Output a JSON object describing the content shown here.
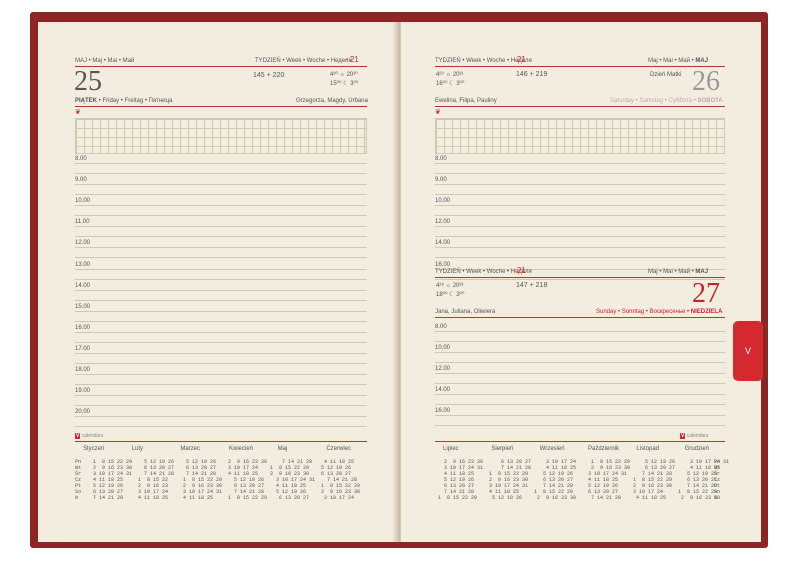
{
  "left_page": {
    "month_header": "MAJ • Maj • Mai • Май",
    "week_label": "TYDZIEŃ • Week • Woche • Неделя",
    "week_number": "- 21",
    "day_number": "25",
    "day_of_year": "145 + 220",
    "sunrise": "4³⁰ ☼ 20³⁰",
    "moonrise": "15⁰⁰ ☾ 3⁰⁰",
    "day_name_strong": "PIĄTEK",
    "day_name_rest": "• Friday • Freitag • Пятница",
    "name_days": "Grzegorza, Magdy, Urbana",
    "times": [
      "8.00",
      "9.00",
      "10.00",
      "11.00",
      "12.00",
      "13.00",
      "14.00",
      "15.00",
      "16.00",
      "17.00",
      "18.00",
      "19.00",
      "20.00"
    ]
  },
  "right_page": {
    "week_label": "TYDZIEŃ • Week • Woche • Неделя",
    "week_number": "- 21",
    "month_header": "Maj • Mai • Май •",
    "month_header_strong": "MAJ",
    "sunrise": "4²⁹ ☼ 20³¹",
    "moonrise": "16⁰⁰ ☾ 3⁰⁰",
    "day_of_year": "146 + 219",
    "day_number": "26",
    "special_day": "Dzień Matki",
    "name_days": "Ewelina, Filipa, Pauliny",
    "day_name_rest": "Saturday • Samstag • Суббота •",
    "day_name_strong": "SOBOTA",
    "times": [
      "8.00",
      "9.00",
      "10.00",
      "12.00",
      "14.00",
      "16.00"
    ]
  },
  "sunday_section": {
    "week_label": "TYDZIEŃ • Week • Woche • Неделя",
    "week_number": "- 21",
    "month_header": "Maj • Mai • Май •",
    "month_header_strong": "MAJ",
    "sunrise": "4²⁸ ☼ 20³³",
    "moonrise": "18⁰⁰ ☾ 3⁰⁰",
    "day_of_year": "147 + 218",
    "day_number": "27",
    "name_days": "Jana, Juliana, Oliwiera",
    "day_name_rest": "Sunday • Sonntag • Воскресенье •",
    "day_name_strong": "NIEDZIELA",
    "times": [
      "8.00",
      "10.00",
      "12.00",
      "14.00",
      "16.00"
    ]
  },
  "tab_label": "V",
  "logo_text": "calendars",
  "left_calendar": {
    "months": [
      "Styczeń",
      "Luty",
      "Marzec",
      "Kwiecień",
      "Maj",
      "Czerwiec"
    ],
    "weekdays": [
      "Pn",
      "Wt",
      "Śr",
      "Cz",
      "Pt",
      "So",
      "N"
    ],
    "body": "   1  8 15 22 29    5 12 19 26    5 12 19 26    2  9 16 23 30     7 14 21 28    4 11 18 25\n   2  9 16 23 30    6 13 20 27    6 13 20 27    3 10 17 24    1  8 15 22 29    5 12 19 26\n   3 10 17 24 31    7 14 21 28    7 14 21 28    4 11 18 25    2  9 16 23 30    6 13 20 27\n   4 11 18 25     1  8 15 22     1  8 15 22 29    5 12 19 26    3 10 17 24 31    7 14 21 28\n   5 12 19 26     2  9 16 23     2  9 16 23 30    6 13 20 27    4 11 18 25     1  8 15 22 29\n   6 13 20 27     3 10 17 24     3 10 17 24 31    7 14 21 28    5 12 19 26     2  9 16 23 30\n   7 14 21 28     4 11 18 25     4 11 18 25     1  8 15 22 29    6 13 20 27     3 10 17 24"
  },
  "right_calendar": {
    "months": [
      "Lipiec",
      "Sierpień",
      "Wrzesień",
      "Październik",
      "Listopad",
      "Grudzień"
    ],
    "weekdays": [
      "Pn",
      "Wt",
      "Śr",
      "Cz",
      "Pt",
      "So",
      "N"
    ],
    "body": "   2  9 16 23 30      6 13 20 27     3 10 17 24     1  8 15 22 29     5 12 19 26     3 10 17 24 31\n   3 10 17 24 31      7 14 21 28     4 11 18 25     2  9 16 23 30     6 13 20 27     4 11 18 25\n   4 11 18 25     1  8 15 22 29     5 12 19 26     3 10 17 24 31     7 14 21 28     5 12 19 26\n   5 12 19 26     2  9 16 23 30     6 13 20 27     4 11 18 25     1  8 15 22 29     6 13 20 27\n   6 13 20 27     3 10 17 24 31     7 14 21 28     5 12 19 26     2  9 16 23 30     7 14 21 28\n   7 14 21 28     4 11 18 25     1  8 15 22 29     6 13 20 27     3 10 17 24     1  8 15 22 29\n 1  8 15 22 29     5 12 19 26     2  9 16 23 30     7 14 21 28     4 11 18 25     2  9 16 23 30"
  }
}
